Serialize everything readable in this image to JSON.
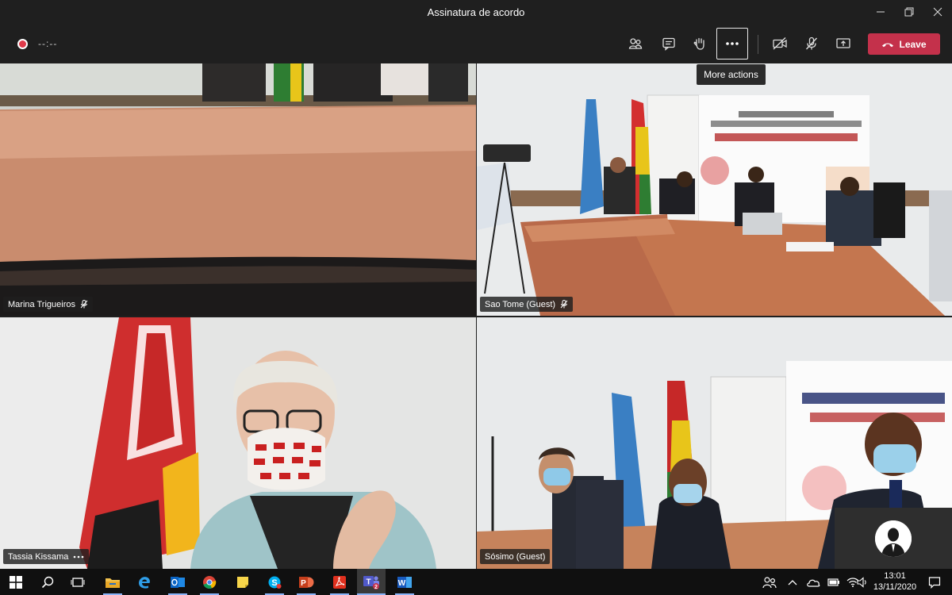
{
  "window": {
    "title": "Assinatura de acordo"
  },
  "toolbar": {
    "timer": "--:--",
    "more_actions_tooltip": "More actions",
    "leave_label": "Leave"
  },
  "participants": [
    {
      "name": "Marina Trigueiros",
      "status_icon": "mic-off-icon"
    },
    {
      "name": "Sao Tome (Guest)",
      "status_icon": "mic-off-icon"
    },
    {
      "name": "Tassia Kissama",
      "status_icon": "more-options-icon"
    },
    {
      "name": "Sósimo (Guest)",
      "status_icon": ""
    }
  ],
  "taskbar": {
    "time": "13:01",
    "date": "13/11/2020",
    "apps": [
      "file-explorer-icon",
      "edge-icon",
      "outlook-icon",
      "chrome-icon",
      "sticky-notes-icon",
      "skype-icon",
      "powerpoint-icon",
      "acrobat-icon",
      "teams-icon",
      "word-icon"
    ]
  },
  "colors": {
    "leave": "#c4314b",
    "recording": "#e03a4a",
    "titlebar": "#1f1f1f"
  }
}
